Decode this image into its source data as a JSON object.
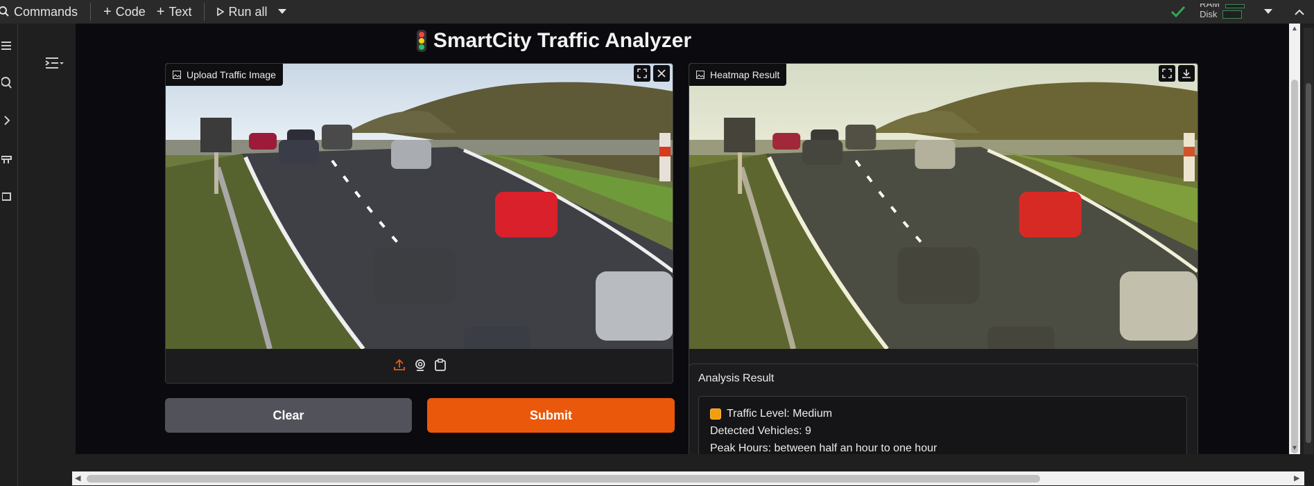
{
  "toolbar": {
    "commands_label": "Commands",
    "code_label": "Code",
    "text_label": "Text",
    "run_all_label": "Run all",
    "ram_label": "RAM",
    "disk_label": "Disk"
  },
  "app": {
    "title": "SmartCity Traffic Analyzer"
  },
  "upload_panel": {
    "label": "Upload Traffic Image"
  },
  "heatmap_panel": {
    "label": "Heatmap Result"
  },
  "buttons": {
    "clear": "Clear",
    "submit": "Submit"
  },
  "analysis": {
    "title": "Analysis Result",
    "traffic_level": "Traffic Level: Medium",
    "detected_vehicles": "Detected Vehicles: 9",
    "peak_hours": "Peak Hours: between half an hour to one hour"
  },
  "colors": {
    "accent": "#ea580c",
    "clear_button": "#52525b",
    "status_ok": "#34a853"
  }
}
